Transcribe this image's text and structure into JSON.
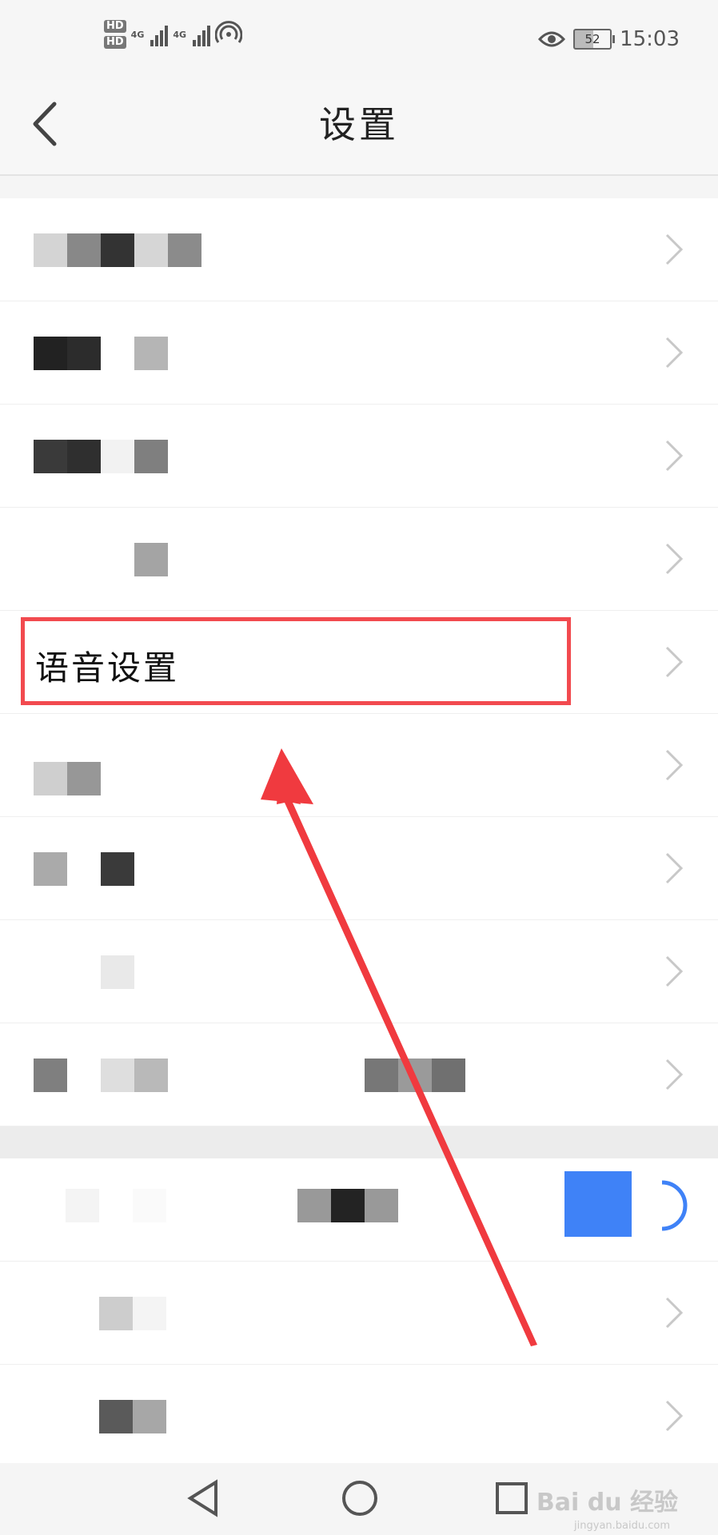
{
  "status_bar": {
    "sim1_label": "HD",
    "sim2_label": "HD",
    "network_1": "4G",
    "network_2": "4G",
    "battery_level": "52",
    "time": "15:03",
    "icons": [
      "signal-icon",
      "wifi-hotspot-icon",
      "eye-icon",
      "battery-icon"
    ]
  },
  "header": {
    "title": "设置",
    "back_icon": "chevron-left-icon"
  },
  "settings_list": {
    "highlighted_item": "语音设置",
    "rows": [
      {
        "label": "",
        "blurred": true
      },
      {
        "label": "",
        "blurred": true
      },
      {
        "label": "",
        "blurred": true
      },
      {
        "label": "",
        "blurred": true
      },
      {
        "label": "语音设置",
        "blurred": false
      },
      {
        "label": "",
        "blurred": true
      },
      {
        "label": "",
        "blurred": true
      },
      {
        "label": "",
        "blurred": true
      },
      {
        "label": "",
        "blurred": true
      },
      {
        "label": "",
        "blurred": true
      },
      {
        "label": "",
        "blurred": true
      },
      {
        "label": "",
        "blurred": true
      }
    ]
  },
  "annotation": {
    "box_color": "#f24a4f",
    "arrow_color": "#f03a3f"
  },
  "watermark": {
    "text": "Bai du 经验",
    "sub": "jingyan.baidu.com"
  },
  "colors": {
    "accent_blue": "#3f82f7"
  }
}
